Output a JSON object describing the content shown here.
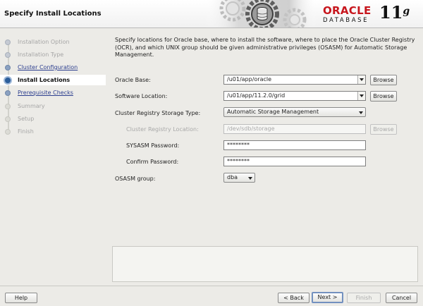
{
  "header": {
    "title": "Specify Install Locations",
    "brand_name": "ORACLE",
    "brand_product": "DATABASE",
    "brand_version": "11",
    "brand_version_suffix": "g",
    "brand_color": "#c7161d"
  },
  "nav": {
    "steps": [
      {
        "label": "Installation Option",
        "state": "done"
      },
      {
        "label": "Installation Type",
        "state": "done"
      },
      {
        "label": "Cluster Configuration",
        "state": "link"
      },
      {
        "label": "Install Locations",
        "state": "current"
      },
      {
        "label": "Prerequisite Checks",
        "state": "link"
      },
      {
        "label": "Summary",
        "state": "pending"
      },
      {
        "label": "Setup",
        "state": "pending"
      },
      {
        "label": "Finish",
        "state": "pending"
      }
    ]
  },
  "content": {
    "intro": "Specify locations for Oracle base, where to install the software, where to place the Oracle Cluster Registry (OCR), and which UNIX group should be given administrative privileges (OSASM) for Automatic Storage Management.",
    "oracle_base": {
      "label": "Oracle Base:",
      "value": "/u01/app/oracle",
      "browse": "Browse"
    },
    "software_location": {
      "label": "Software Location:",
      "value": "/u01/app/11.2.0/grid",
      "browse": "Browse"
    },
    "storage_type": {
      "label": "Cluster Registry Storage Type:",
      "value": "Automatic Storage Management"
    },
    "registry_location": {
      "label": "Cluster Registry Location:",
      "placeholder": "/dev/sdb/storage",
      "browse": "Browse"
    },
    "sysasm_password": {
      "label": "SYSASM Password:",
      "value": "********"
    },
    "confirm_password": {
      "label": "Confirm Password:",
      "value": "********"
    },
    "osasm_group": {
      "label": "OSASM group:",
      "value": "dba"
    }
  },
  "footer": {
    "help": "Help",
    "back": "< Back",
    "next": "Next >",
    "finish": "Finish",
    "cancel": "Cancel"
  }
}
